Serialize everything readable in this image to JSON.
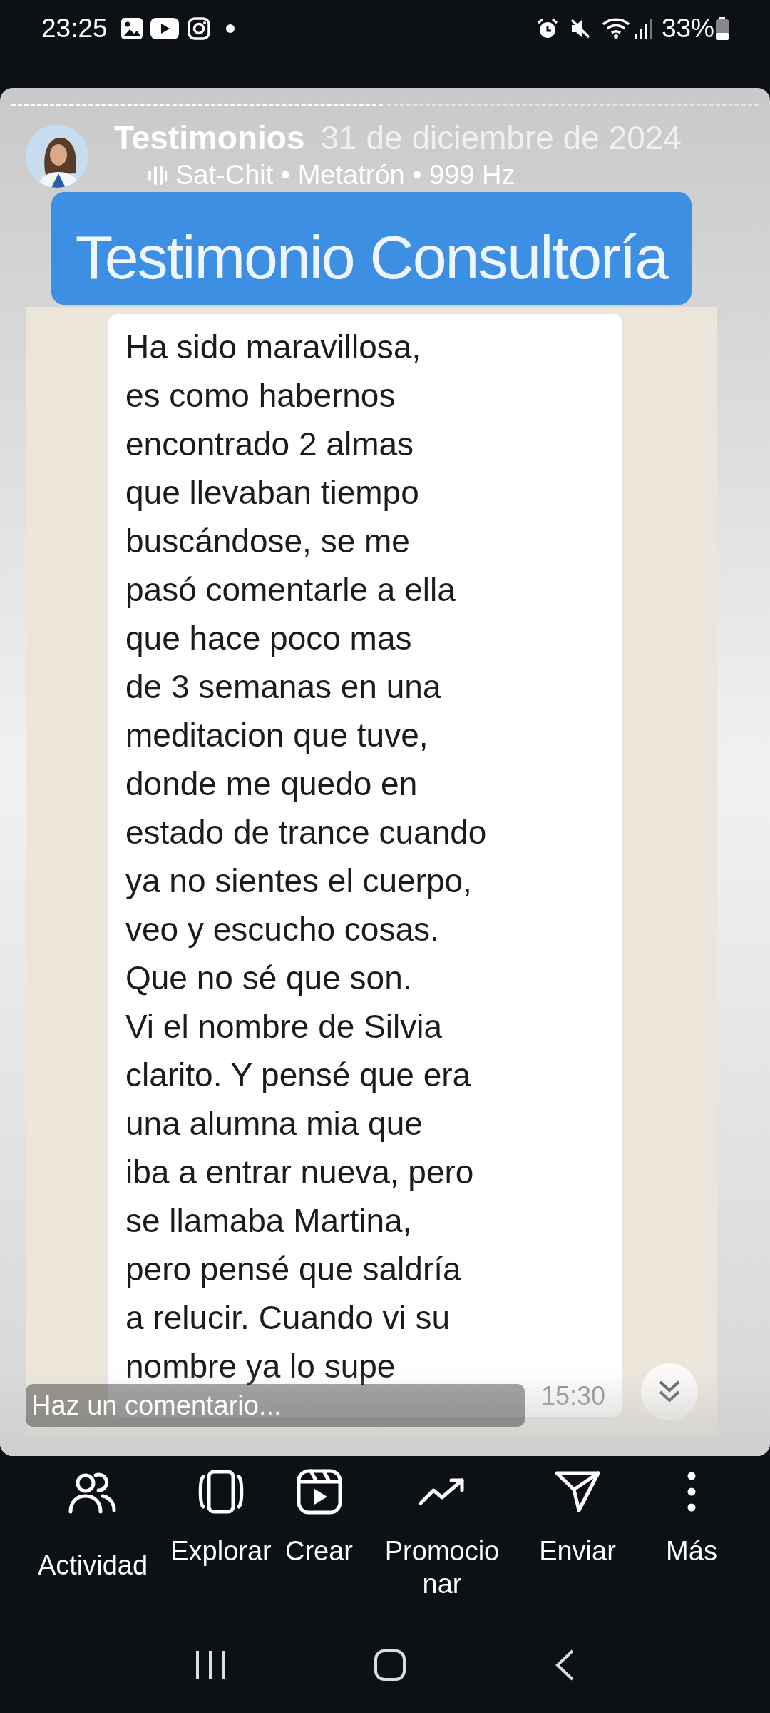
{
  "status_bar": {
    "time": "23:25",
    "battery": "33%"
  },
  "story": {
    "progress": [
      {
        "seen": true
      },
      {
        "seen": false
      }
    ],
    "account": "Testimonios",
    "date": "31 de diciembre de 2024",
    "music": "Sat-Chit • Metatrón • 999 Hz",
    "banner": "Testimonio Consultoría",
    "message": {
      "text": "Ha sido maravillosa,\nes como habernos\nencontrado 2 almas\nque llevaban tiempo\nbuscándose, se me\npasó comentarle a ella\nque hace poco mas\nde 3 semanas en una\nmeditacion que tuve,\ndonde me quedo en\nestado de trance cuando\nya no sientes el cuerpo,\nveo y escucho cosas.\nQue no sé que son.\nVi el nombre de Silvia\nclarito. Y pensé que era\nuna alumna mia que\niba a entrar nueva, pero\nse llamaba Martina,\npero pensé que saldría\na relucir. Cuando vi su\nnombre ya lo supe",
      "time": "15:30"
    },
    "comment": {
      "placeholder": "Haz un comentario..."
    }
  },
  "actions": [
    {
      "kind": "activity",
      "label": "Actividad"
    },
    {
      "kind": "explore",
      "label": "Explorar"
    },
    {
      "kind": "create",
      "label": "Crear"
    },
    {
      "kind": "promote",
      "label": "Promocio\nnar"
    },
    {
      "kind": "send",
      "label": "Enviar"
    },
    {
      "kind": "more",
      "label": "Más"
    }
  ]
}
